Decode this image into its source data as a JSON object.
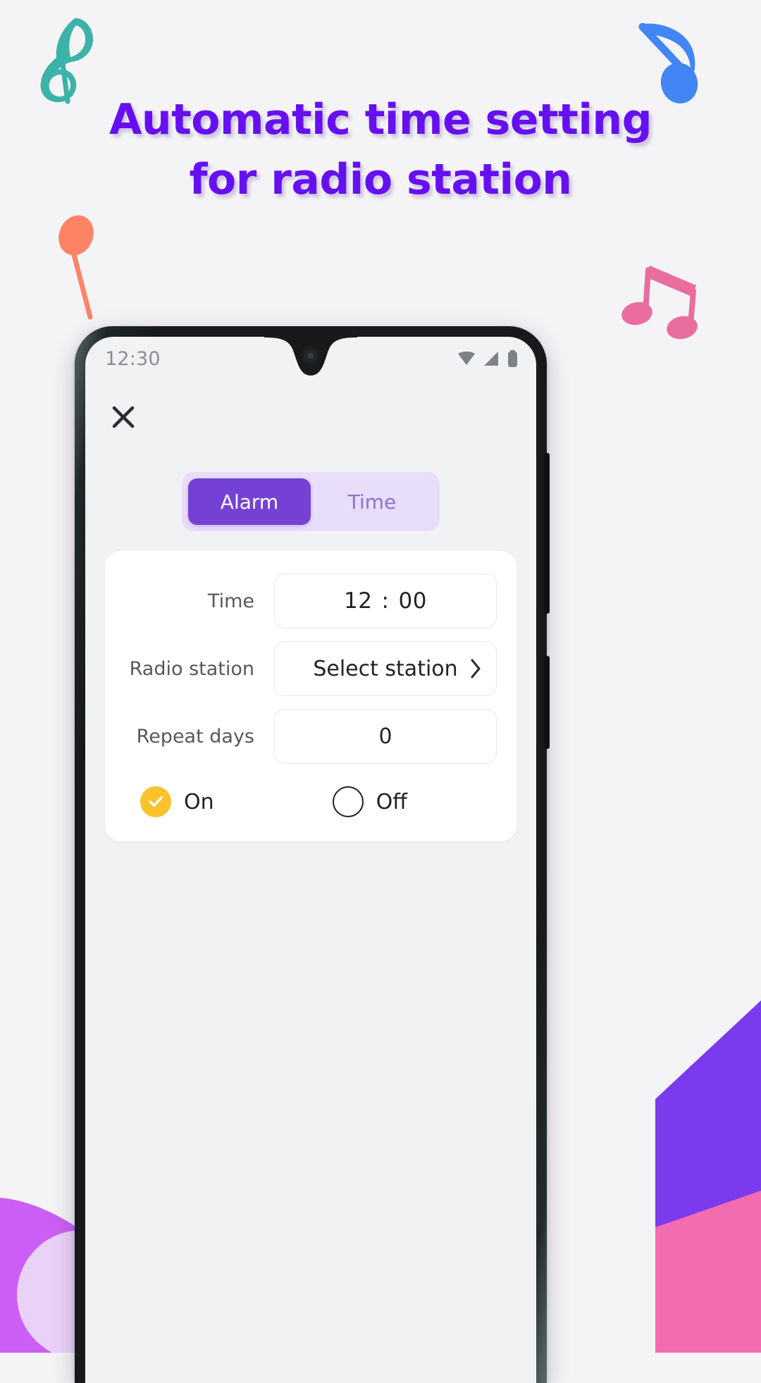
{
  "promo": {
    "headline_line1": "Automatic time setting",
    "headline_line2": "for radio station",
    "headline_color": "#6610f2",
    "background_color": "#f4f4f6",
    "decorations": [
      {
        "name": "treble-clef-note",
        "color": "#3cb3a8"
      },
      {
        "name": "eighth-note",
        "color": "#4285f4"
      },
      {
        "name": "quarter-note",
        "color": "#fc8464"
      },
      {
        "name": "beamed-notes",
        "color": "#ea6d9f"
      }
    ],
    "blob_colors": {
      "violet": "#cb5ff5",
      "lavender": "#eddcf6",
      "purple": "#7c3aed",
      "pink": "#f46cb0"
    }
  },
  "device": {
    "frame_color": "#17191a",
    "screen_background": "#f1f2f4"
  },
  "status_bar": {
    "time": "12:30",
    "icons": [
      "wifi-icon",
      "cellular-signal-icon",
      "battery-icon"
    ],
    "icon_color": "#7e8186"
  },
  "app": {
    "close_label": "✕",
    "accent_color": "#7540d4",
    "segmented_control": {
      "track_color": "#e8ddfb",
      "tabs": [
        {
          "label": "Alarm",
          "active": true
        },
        {
          "label": "Time",
          "active": false
        }
      ]
    },
    "form": {
      "rows": [
        {
          "label": "Time",
          "value": "12",
          "value2": "00",
          "separator": ":",
          "type": "time"
        },
        {
          "label": "Radio station",
          "value": "Select station",
          "type": "select",
          "chevron": "chevron-right-icon"
        },
        {
          "label": "Repeat days",
          "value": "0",
          "type": "number"
        }
      ]
    },
    "toggle": {
      "options": [
        {
          "label": "On",
          "selected": true,
          "color": "#fbc22b"
        },
        {
          "label": "Off",
          "selected": false,
          "color": "#1f2022"
        }
      ]
    }
  }
}
